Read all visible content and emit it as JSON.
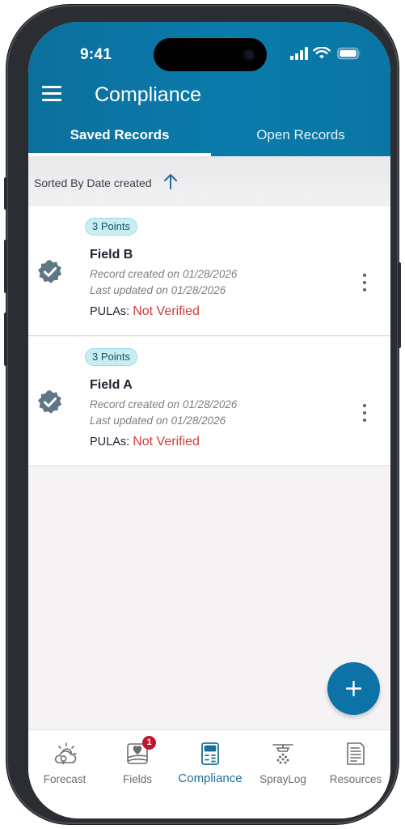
{
  "status_bar": {
    "time": "9:41"
  },
  "header": {
    "title": "Compliance",
    "menu_icon": "hamburger-menu-icon"
  },
  "tabs": [
    {
      "label": "Saved Records",
      "active": true
    },
    {
      "label": "Open Records",
      "active": false
    }
  ],
  "sort": {
    "label": "Sorted By Date created",
    "direction_icon": "arrow-up-icon"
  },
  "records": [
    {
      "points": "3 Points",
      "name": "Field B",
      "created": "Record created on 01/28/2026",
      "updated": "Last updated on 01/28/2026",
      "pulas_label": "PULAs:",
      "pulas_value": "Not Verified"
    },
    {
      "points": "3 Points",
      "name": "Field A",
      "created": "Record created on 01/28/2026",
      "updated": "Last updated on 01/28/2026",
      "pulas_label": "PULAs:",
      "pulas_value": "Not Verified"
    }
  ],
  "fab": {
    "icon": "plus-icon"
  },
  "bottom_nav": [
    {
      "label": "Forecast",
      "icon": "cloud-sun-icon"
    },
    {
      "label": "Fields",
      "icon": "field-heart-icon",
      "badge": "1"
    },
    {
      "label": "Compliance",
      "icon": "calculator-icon",
      "active": true
    },
    {
      "label": "SprayLog",
      "icon": "sprayer-icon"
    },
    {
      "label": "Resources",
      "icon": "document-icon"
    }
  ],
  "colors": {
    "header": "#0a7bab",
    "accent": "#0d72a6",
    "not_verified": "#d13c38",
    "badge_bg": "#c7eef1",
    "nav_badge": "#c0152e"
  }
}
